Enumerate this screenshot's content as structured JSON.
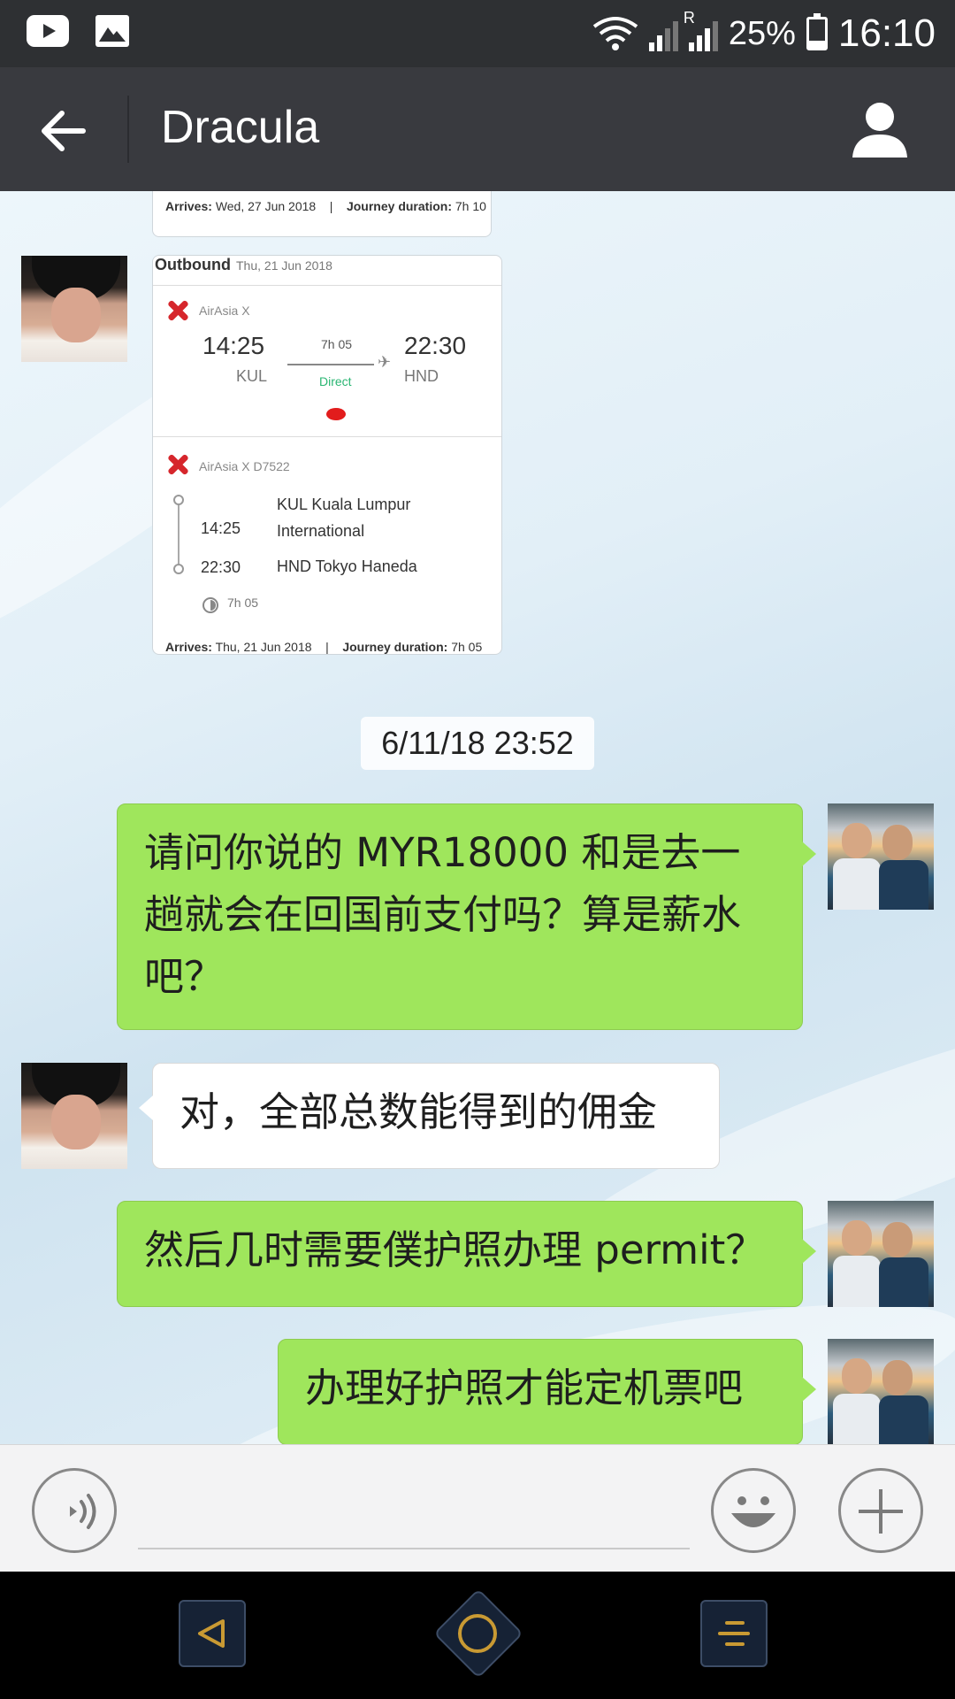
{
  "status_bar": {
    "battery": "25%",
    "time": "16:10",
    "signal_label": "R",
    "icons": [
      "youtube-icon",
      "gallery-icon",
      "wifi-icon",
      "signal-icon",
      "battery-icon"
    ]
  },
  "header": {
    "title": "Dracula",
    "back_icon": "arrow-left-icon",
    "profile_icon": "person-icon"
  },
  "chat": {
    "prev_card": {
      "arrives_label": "Arrives:",
      "arrives_value": "Wed, 27 Jun 2018",
      "separator": "|",
      "duration_label": "Journey duration:",
      "duration_value": "7h 10"
    },
    "flight_card": {
      "title": "Outbound",
      "date": "Thu, 21 Jun 2018",
      "airline": "AirAsia X",
      "depart_time": "14:25",
      "depart_code": "KUL",
      "arrive_time": "22:30",
      "arrive_code": "HND",
      "duration": "7h 05",
      "direct": "Direct",
      "flight_no": "AirAsia X D7522",
      "seg_depart_time": "14:25",
      "seg_depart_place": "KUL Kuala Lumpur International",
      "seg_arrive_time": "22:30",
      "seg_arrive_place": "HND Tokyo Haneda",
      "seg_duration": "7h 05",
      "arrives_label": "Arrives:",
      "arrives_value": "Thu, 21 Jun 2018",
      "separator": "|",
      "duration_label": "Journey duration:",
      "duration_value": "7h 05"
    },
    "timestamp": "6/11/18 23:52",
    "messages": [
      {
        "from": "me",
        "text": "请问你说的 MYR18000 和是去一趟就会在回国前支付吗？算是薪水吧？"
      },
      {
        "from": "them",
        "text": "对，全部总数能得到的佣金"
      },
      {
        "from": "me",
        "text": "然后几时需要僕护照办理 permit？"
      },
      {
        "from": "me",
        "text": "办理好护照才能定机票吧"
      }
    ]
  },
  "input_bar": {
    "text": "",
    "icons": [
      "voice-icon",
      "emoji-icon",
      "plus-icon"
    ]
  },
  "nav_bar": {
    "icons": [
      "nav-back-icon",
      "nav-home-icon",
      "nav-menu-icon"
    ]
  },
  "colors": {
    "status_bar": "#2e3033",
    "title_bar": "#393a3f",
    "my_bubble": "#9fe65c",
    "their_bubble": "#ffffff",
    "direct_green": "#2bb673",
    "airasia_red": "#d6262c",
    "nav_accent": "#c99a33"
  }
}
